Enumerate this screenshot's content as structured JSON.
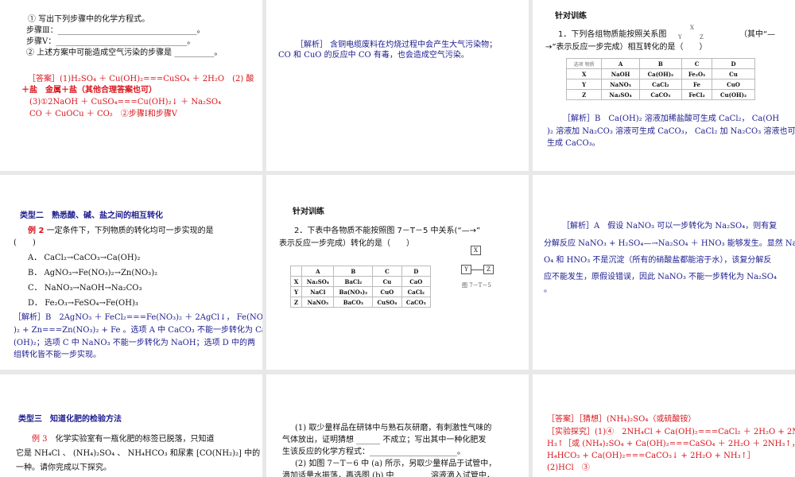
{
  "s1": {
    "l1": "① 写出下列步骤中的化学方程式。",
    "l2": "步骤Ⅲ：___________________________________。",
    "l3": "步骤Ⅴ：_________________________________。",
    "l4": "② 上述方案中可能造成空气污染的步骤是 __________。",
    "a1": "［答案］(1)H₂SO₄ ＋ Cu(OH)₂===CuSO₄ ＋ 2H₂O　(2) 酸",
    "a2": "＋盐　金属＋盐（其他合理答案也可）",
    "a3": "(3)①2NaOH ＋ CuSO₄===Cu(OH)₂↓ ＋ Na₂SO₄",
    "a4": "CO ＋ CuOCu ＋ CO₂　②步骤Ⅰ和步骤Ⅴ"
  },
  "s2": {
    "l1": "［解析］ 含铜电缆废料在灼烧过程中会产生大气污染物；",
    "l2": "CO 和 CuO 的反应中 CO 有毒，也会造成空气污染。"
  },
  "s3": {
    "title": "针对训练",
    "q1": "1．下列各组物质能按照关系图",
    "q1b": "（其中“—",
    "q2": "→”表示反应一步完成）相互转化的是（　　）",
    "diag": [
      "X",
      "Y",
      "Z"
    ],
    "header": [
      "选项\n物质",
      "A",
      "B",
      "C",
      "D"
    ],
    "rows": [
      [
        "X",
        "NaOH",
        "Ca(OH)₂",
        "Fe₂O₃",
        "Cu"
      ],
      [
        "Y",
        "NaNO₃",
        "CaCl₂",
        "Fe",
        "CuO"
      ],
      [
        "Z",
        "Na₂SO₄",
        "CaCO₃",
        "FeCl₂",
        "Cu(OH)₂"
      ]
    ],
    "e1": "［解析］B　Ca(OH)₂ 溶液加稀盐酸可生成 CaCl₂， Ca(OH",
    "e2": ")₂ 溶液加 Na₂CO₃ 溶液可生成 CaCO₃， CaCl₂ 加 Na₂CO₃ 溶液也可",
    "e3": "生成 CaCO₃。"
  },
  "s4": {
    "title": "类型二　熟悉酸、碱、盐之间的相互转化",
    "ex": "例 2",
    "q": "一定条件下，下列物质的转化均可一步实现的是",
    "paren": "(　　)",
    "opts": [
      "A． CaCl₂→CaCO₃→Ca(OH)₂",
      "B． AgNO₃→Fe(NO₃)₂→Zn(NO₃)₂",
      "C． NaNO₃→NaOH→Na₂CO₃",
      "D． Fe₂O₃→FeSO₄→Fe(OH)₃"
    ],
    "e1": "［解析］B　2AgNO₃ ＋ FeCl₂===Fe(NO₃)₂ ＋ 2AgCl↓， Fe(NO₃",
    "e2": ")₂ + Zn===Zn(NO₃)₂ + Fe 。选项 A 中 CaCO₃ 不能一步转化为 Ca",
    "e3": "(OH)₂；选项 C 中 NaNO₃ 不能一步转化为 NaOH；选项 D 中的两",
    "e4": "组转化皆不能一步实现。"
  },
  "s5": {
    "title": "针对训练",
    "q1": "2．下表中各物质不能按照图 7－T－5 中关系(“—→”",
    "q2": "表示反应一步完成）转化的是（　　）",
    "header": [
      "",
      "A",
      "B",
      "C",
      "D"
    ],
    "rows": [
      [
        "X",
        "Na₂SO₄",
        "BaCl₂",
        "Cu",
        "CaO"
      ],
      [
        "Y",
        "NaCl",
        "Ba(NO₃)₂",
        "CuO",
        "CaCl₂"
      ],
      [
        "Z",
        "NaNO₃",
        "BaCO₃",
        "CuSO₄",
        "CaCO₃"
      ]
    ],
    "diag": [
      "X",
      "Y",
      "Z"
    ],
    "caption": "图 7－T－5"
  },
  "s6": {
    "l1": "［解析］A　假设 NaNO₃ 可以一步转化为 Na₂SO₄，则有复",
    "l2": "分解反应 NaNO₃ + H₂SO₄—→Na₂SO₄ ＋ HNO₃ 能够发生。显然 Na₂S",
    "l3": "O₄ 和 HNO₃ 不是沉淀（所有的硝酸盐都能溶于水），该复分解反",
    "l4": "应不能发生，原假设错误，因此 NaNO₃ 不能一步转化为 Na₂SO₄",
    "l5": "。"
  },
  "s7": {
    "title": "类型三　知道化肥的检验方法",
    "ex": "例 3",
    "l1": "化学实验室有一瓶化肥的标签已脱落，只知道",
    "l2": "它是 NH₄Cl 、 (NH₄)₂SO₄ 、 NH₄HCO₃ 和尿素 [CO(NH₂)₂] 中的",
    "l3": "一种。请你完成以下探究。"
  },
  "s8": {
    "l1": "(1) 取少量样品在研钵中与熟石灰研磨，有刺激性气味的",
    "l2": "气体放出，证明猜想 ______ 不成立；写出其中一种化肥发",
    "l3": "生该反应的化学方程式：______________________。",
    "l4": "(2) 如图 7－T－6 中 (a) 所示，另取少量样品于试管中，",
    "l5": "滴加适量水振荡，再选图 (b) 中 ________ 溶液滴入试管中，"
  },
  "s9": {
    "l1": "［答案］［猜想］(NH₄)₂SO₄（或硫酸铵）",
    "l2": "［实验探究］(1)④　2NH₄Cl + Ca(OH)₂===CaCl₂ ＋ 2H₂O + 2N",
    "l3": "H₃↑［或 (NH₄)₂SO₄ + Ca(OH)₂===CaSO₄ ＋ 2H₂O ＋ 2NH₃↑，或 N",
    "l4": "H₄HCO₃ + Ca(OH)₂===CaCO₃↓ + 2H₂O + NH₃↑］",
    "l5": "(2)HCl　③"
  }
}
